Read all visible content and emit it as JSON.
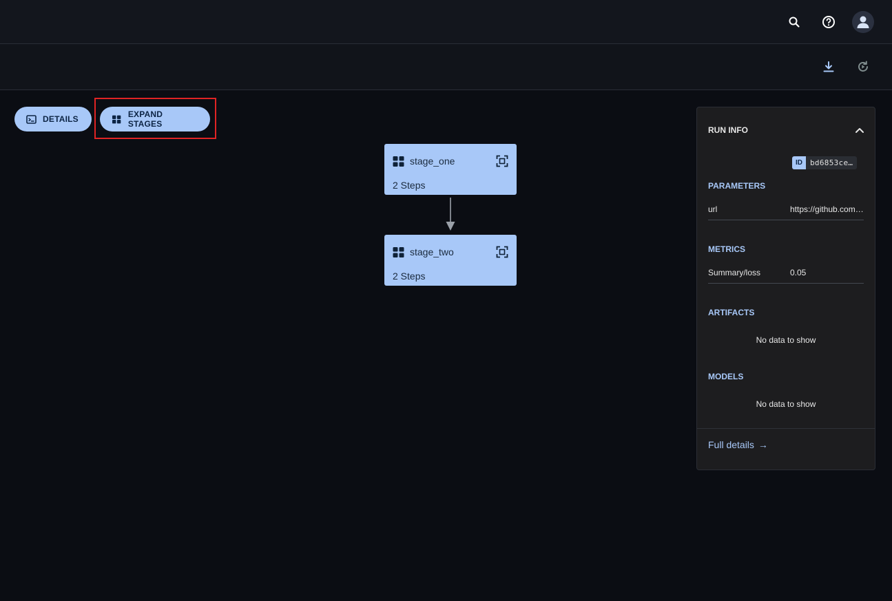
{
  "header": {
    "search_icon": "search-icon",
    "help_icon": "help-icon",
    "avatar_icon": "user-icon"
  },
  "toolbar": {
    "download_icon": "download-icon",
    "refresh_icon": "refresh-icon"
  },
  "actions": {
    "details_label": "DETAILS",
    "expand_label": "EXPAND STAGES"
  },
  "graph": {
    "stages": [
      {
        "name": "stage_one",
        "steps": "2 Steps"
      },
      {
        "name": "stage_two",
        "steps": "2 Steps"
      }
    ]
  },
  "run_info": {
    "title": "RUN INFO",
    "id_label": "ID",
    "id_value": "bd6853ce…",
    "parameters_title": "PARAMETERS",
    "parameters": [
      {
        "key": "url",
        "value": "https://github.com/…"
      }
    ],
    "metrics_title": "METRICS",
    "metrics": [
      {
        "key": "Summary/loss",
        "value": "0.05"
      }
    ],
    "artifacts_title": "ARTIFACTS",
    "artifacts_empty": "No data to show",
    "models_title": "MODELS",
    "models_empty": "No data to show",
    "full_details": "Full details",
    "full_details_arrow": "→"
  },
  "colors": {
    "accent": "#a8c8f8",
    "background": "#0b0d13",
    "highlight": "#e02424"
  }
}
